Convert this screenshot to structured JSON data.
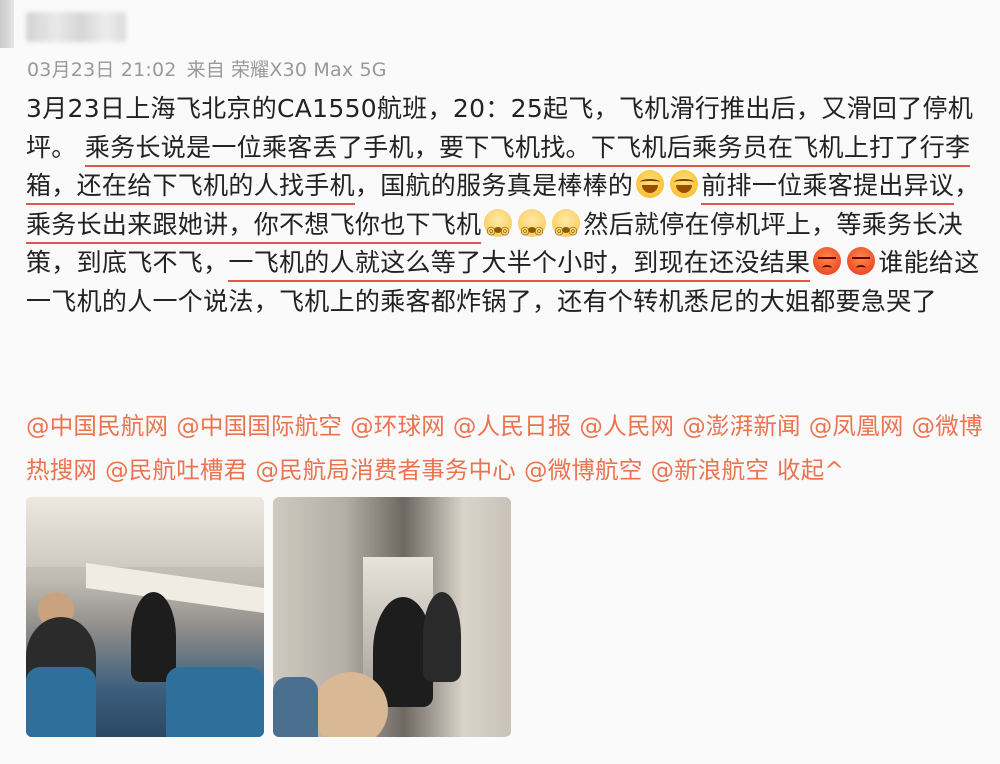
{
  "meta": {
    "time": "03月23日 21:02",
    "source_prefix": "来自",
    "device": "荣耀X30 Max 5G"
  },
  "post": {
    "s1": "3月23日上海飞北京的CA1550航班，20：25起飞，飞机滑行推出后，又滑回了停机坪。",
    "s2": "乘务长说是一位乘客丢了手机，要下飞机找。下飞机后乘务员在飞机上打了行李箱，还在给下飞机的人找手机",
    "s3": "，国航的服务真是棒棒的",
    "s4": "前排一位乘客提出异议",
    "s5": "，",
    "s6": "乘务长出来跟她讲，你不想飞你也下飞机",
    "s7": "然后就停在停机坪上，等乘务长决策，到底飞不飞，",
    "s8": "一飞机的人就这么等了大半个小时，到现在还没结果",
    "s9": "谁能给这一飞机的人一个说法，飞机上的乘客都炸锅了，还有个转机悉尼的大姐都要急哭了",
    "emoji_laugh": "laughing-tears-icon",
    "emoji_dizzy": "dizzy-face-icon",
    "emoji_angry": "angry-face-icon"
  },
  "mentions": [
    "@中国民航网",
    "@中国国际航空",
    "@环球网",
    "@人民日报",
    "@人民网",
    "@澎湃新闻",
    "@凤凰网",
    "@微博热搜网",
    "@民航吐槽君",
    "@民航局消费者事务中心",
    "@微博航空",
    "@新浪航空"
  ],
  "collapse_label": "收起^",
  "colors": {
    "link": "#eb7350",
    "underline": "#e2554f",
    "text": "#222222",
    "meta": "#999999"
  },
  "photos": [
    {
      "name": "cabin-photo-1",
      "icon": "airplane-cabin-image"
    },
    {
      "name": "cabin-photo-2",
      "icon": "airplane-aisle-image"
    }
  ]
}
